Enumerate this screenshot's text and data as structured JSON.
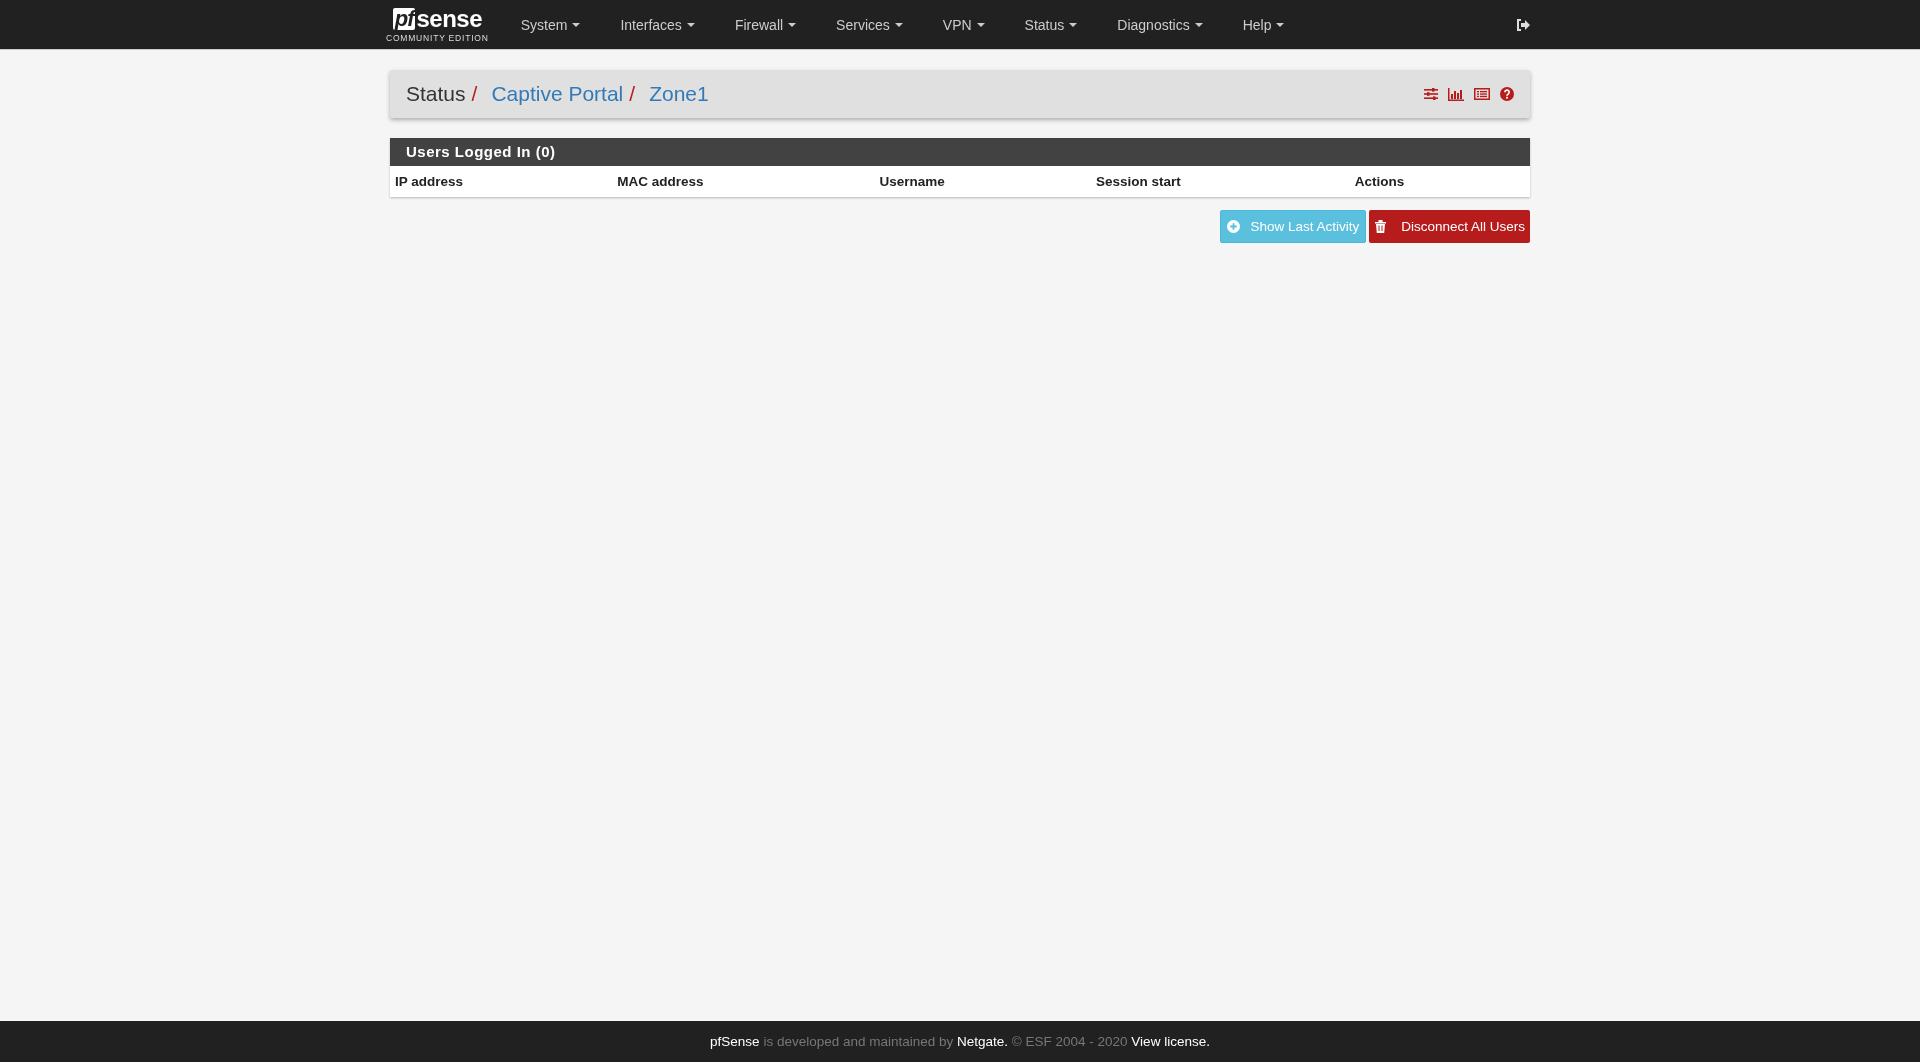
{
  "logo": {
    "mark": "pf",
    "word": "sense",
    "edition": "COMMUNITY EDITION"
  },
  "menu": [
    "System",
    "Interfaces",
    "Firewall",
    "Services",
    "VPN",
    "Status",
    "Diagnostics",
    "Help"
  ],
  "breadcrumb": [
    {
      "label": "Status",
      "kind": "text",
      "separator": "/"
    },
    {
      "label": "Captive Portal",
      "kind": "link",
      "separator": "/"
    },
    {
      "label": "Zone1",
      "kind": "link"
    }
  ],
  "panel": {
    "title": "Users Logged In (0)",
    "columns": [
      "IP address",
      "MAC address",
      "Username",
      "Session start",
      "Actions"
    ]
  },
  "buttons": [
    {
      "label": "Show Last Activity",
      "kind": "info"
    },
    {
      "label": "Disconnect All Users",
      "kind": "danger"
    }
  ],
  "footer": [
    {
      "text": "pfSense",
      "kind": "link"
    },
    {
      "text": " is developed and maintained by ",
      "kind": "text"
    },
    {
      "text": "Netgate.",
      "kind": "link"
    },
    {
      "text": " © ESF 2004 - 2020 ",
      "kind": "text"
    },
    {
      "text": "View license.",
      "kind": "link"
    }
  ]
}
